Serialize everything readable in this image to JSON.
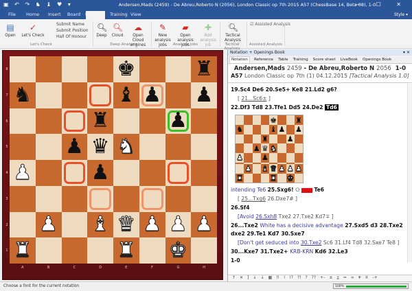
{
  "window": {
    "title": "Andersen,Mads (2459) - De Abreu,Roberto N (2056), London Classic op 7th 2015  A57  (ChessBase 14, Beta 08), 1-0",
    "quick_access": "▣ ↶ ↷ ♞ ♝ ♥ ▾",
    "controls": "— ☐ ✕"
  },
  "tabs": [
    {
      "label": "File"
    },
    {
      "label": "Home"
    },
    {
      "label": "Insert"
    },
    {
      "label": "Board"
    },
    {
      "label": "Report"
    },
    {
      "label": ""
    },
    {
      "label": "Training"
    },
    {
      "label": "View"
    }
  ],
  "style_label": "Style ▾",
  "ribbon": {
    "lets_check": {
      "open": "Open",
      "lets_check": "Let's Check",
      "submit_name": "Submit Name",
      "submit_position": "Submit Position",
      "hall": "Hall Of Honour",
      "group": "Let's Check"
    },
    "deep": {
      "deep": "Deep",
      "cloud": "Cloud",
      "open_cloud": "Open Cloud engines",
      "group": "Deep Analysis"
    },
    "jobs": {
      "new": "New analysis jobs",
      "open": "Open analysis jobs",
      "add": "Add analysis job",
      "group": "Analysis jobs"
    },
    "tactical": {
      "btn": "Tactical Analysis",
      "group": "Tactical Analysis"
    },
    "assisted": {
      "checkbox": "Assisted Analysis",
      "checked": true,
      "group": "Assisted Analysis"
    }
  },
  "board": {
    "rows": [
      "....k..r",
      "n...b.p.p",
      "...r..p.",
      "..pqN...",
      "P..p....",
      "........",
      ".P.BQPPP",
      "R...R.K."
    ],
    "ranks": [
      "8",
      "7",
      "6",
      "5",
      "4",
      "3",
      "2",
      "1"
    ],
    "files": [
      "A",
      "B",
      "C",
      "D",
      "E",
      "F",
      "G",
      "H"
    ],
    "highlights": {
      "d7": "#e8502a",
      "c6": "#e8502a",
      "c4": "#e8502a",
      "g4": "#e8502a",
      "f7": "#f0956a",
      "d3": "#f0956a",
      "f3": "#f0956a",
      "g6": "#3cbf2a"
    },
    "colors": {
      "light": "#efdcc0",
      "dark": "#c8692f",
      "frame": "#7a1418"
    }
  },
  "panel": {
    "header": "Notation + Openings Book",
    "header_controls": "▾ ✕",
    "tabs": [
      "Notation",
      "Reference",
      "Table",
      "Training",
      "Score sheet",
      "LiveBook",
      "Openings Book"
    ],
    "white": "Andersen,Mads",
    "white_elo": "2459",
    "sep": " - ",
    "black": "De Abreu,Roberto N",
    "black_elo": "2056",
    "result": "1-0",
    "eco": "A57",
    "event": "London Classic op 7th (1) 04.12.2015",
    "annotator": "[Tactical Analysis 1.0]",
    "lines": [
      [
        [
          "mv",
          "19.Sc4  De6  20.Se5+  Ke8  21.Ld2  g6?"
        ]
      ],
      [
        [
          "vr ind",
          "[ "
        ],
        [
          "vr ul",
          "21...Sc6±"
        ],
        [
          "vr",
          " ]"
        ]
      ],
      [
        [
          "mv",
          "22.Df3  Td8  23.Tfe1  Dd5  24.De2 "
        ],
        [
          "cur",
          "Td6"
        ]
      ],
      "DIAGRAM",
      [
        [
          "cm",
          "intending Te6 "
        ],
        [
          "mv",
          " 25.Sxg6! "
        ],
        [
          "vr",
          " ⭘ "
        ],
        [
          "color",
          ""
        ],
        [
          "mv",
          "  Te6"
        ]
      ],
      [
        [
          "vr ind",
          "[ "
        ],
        [
          "vr ul",
          "25...Txg6"
        ],
        [
          "vr",
          " 26.Dxe7# ]"
        ]
      ],
      [
        [
          "mv",
          "26.Sf4"
        ]
      ],
      [
        [
          "cm ind",
          "[Avoid "
        ],
        [
          "cm ul",
          "26.Sxh8"
        ],
        [
          "vr",
          " Txe2  27.Txe2  Kd7∓ ]"
        ]
      ],
      [
        [
          "mv",
          "26...Txe2 "
        ],
        [
          "cm",
          "White has a decisive advantage "
        ],
        [
          "mv",
          " 27.Sxd5  d3  28.Txe2"
        ]
      ],
      [
        [
          "mv",
          "dxe2  29.Te1  Kd7  30.Sxe7"
        ]
      ],
      [
        [
          "cm ind",
          "[Don't get seduced into "
        ],
        [
          "cm ul",
          "30.Txe2"
        ],
        [
          "vr",
          " Sc6  31.Lf4  Td8  32.Sxe7  Te8 ]"
        ]
      ],
      [
        [
          "mv",
          "30...Kxe7  31.Txe2+ "
        ],
        [
          "cm",
          "KRB-KRN "
        ],
        [
          "mv",
          " Kd6  32.Le3"
        ]
      ],
      [
        [
          "mv",
          "1-0"
        ]
      ]
    ],
    "toolbar": [
      "↑",
      "✕",
      "]",
      "↓",
      "↓",
      "▦",
      "!!",
      "!",
      "!?",
      "?!",
      "?",
      "??",
      "+-",
      "±",
      "⩲",
      "=",
      "∞",
      "⩱",
      "∓",
      "-+"
    ]
  },
  "status": {
    "text": "Choose a font for the current notation"
  },
  "progress": {
    "label": "100%",
    "value": 100
  }
}
